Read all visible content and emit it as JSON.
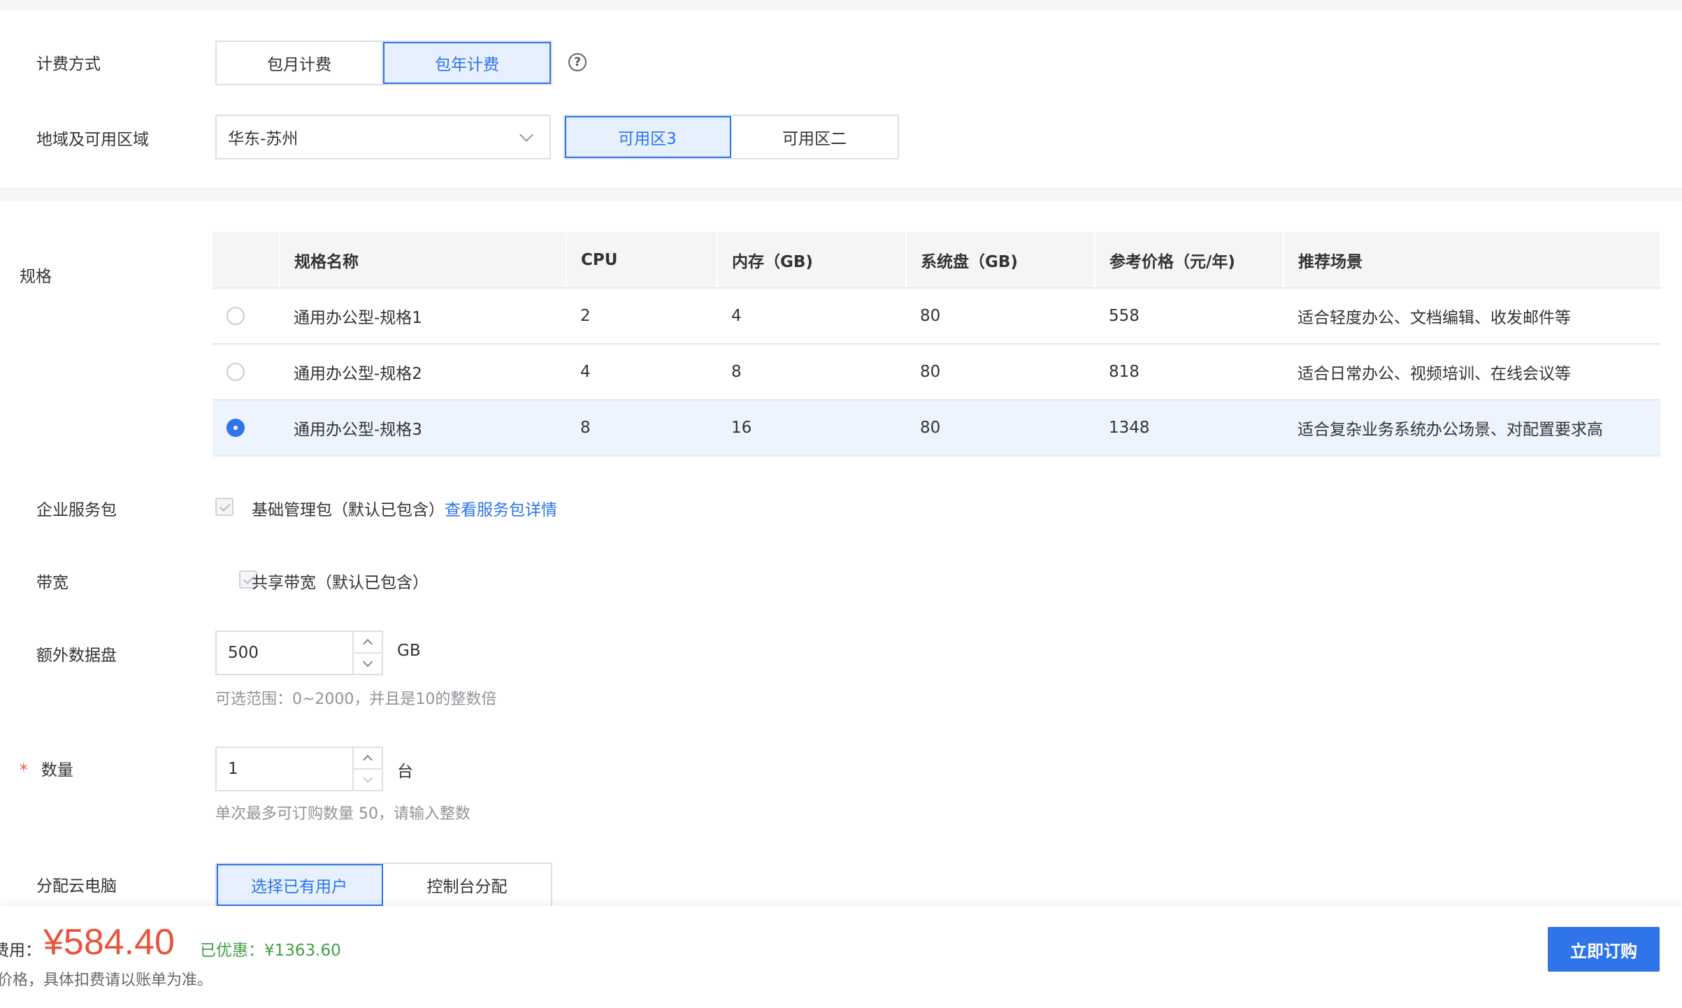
{
  "billing": {
    "label": "计费方式",
    "options": [
      "包月计费",
      "包年计费"
    ],
    "selected": "包年计费",
    "help_icon": "question-circle-icon"
  },
  "region": {
    "label": "地域及可用区域",
    "selected_region": "华东-苏州",
    "zones": [
      "可用区3",
      "可用区二"
    ],
    "selected_zone": "可用区3"
  },
  "spec": {
    "label": "规格",
    "headers": [
      "规格名称",
      "CPU",
      "内存（GB)",
      "系统盘（GB)",
      "参考价格（元/年)",
      "推荐场景"
    ],
    "rows": [
      {
        "name": "通用办公型-规格1",
        "cpu": "2",
        "memory": "4",
        "disk": "80",
        "price": "558",
        "scene": "适合轻度办公、文档编辑、收发邮件等",
        "selected": false
      },
      {
        "name": "通用办公型-规格2",
        "cpu": "4",
        "memory": "8",
        "disk": "80",
        "price": "818",
        "scene": "适合日常办公、视频培训、在线会议等",
        "selected": false
      },
      {
        "name": "通用办公型-规格3",
        "cpu": "8",
        "memory": "16",
        "disk": "80",
        "price": "1348",
        "scene": "适合复杂业务系统办公场景、对配置要求高",
        "selected": true
      }
    ]
  },
  "service_pack": {
    "label": "企业服务包",
    "text": "基础管理包（默认已包含）",
    "link": "查看服务包详情"
  },
  "bandwidth": {
    "label": "带宽",
    "text": "共享带宽（默认已包含）"
  },
  "data_disk": {
    "label": "额外数据盘",
    "value": "500",
    "unit": "GB",
    "hint": "可选范围：0~2000，并且是10的整数倍"
  },
  "quantity": {
    "required_mark": "*",
    "label": "数量",
    "value": "1",
    "unit": "台",
    "hint": "单次最多可订购数量 50，请输入整数"
  },
  "assign": {
    "label": "分配云电脑",
    "options": [
      "选择已有用户",
      "控制台分配"
    ],
    "selected": "选择已有用户"
  },
  "footer": {
    "fee_label_partial": "费用：",
    "price": "¥584.40",
    "discount_label": "已优惠：",
    "discount_value": "¥1363.60",
    "note_partial": "价格，具体扣费请以账单为准。",
    "buy_button": "立即订购"
  }
}
